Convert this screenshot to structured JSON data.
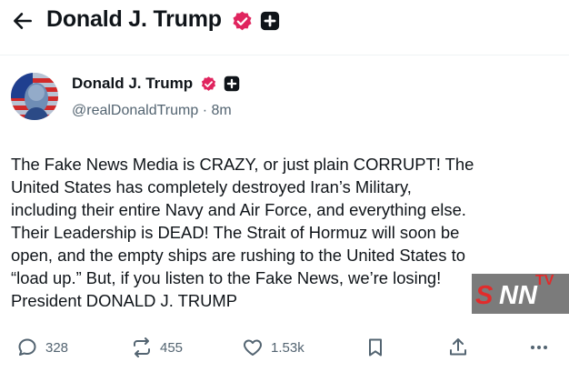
{
  "header": {
    "title": "Donald J. Trump"
  },
  "post": {
    "author": {
      "display_name": "Donald J. Trump",
      "handle": "@realDonaldTrump",
      "separator": "·",
      "time": "8m"
    },
    "text": "The Fake News Media is CRAZY, or just plain CORRUPT! The\nUnited States has completely destroyed Iran’s Military,\nincluding their entire Navy and Air Force, and everything else.\nTheir Leadership is DEAD! The Strait of Hormuz will soon be\nopen, and the empty ships are rushing to the United States to\n“load up.” But, if you listen to the Fake News, we’re losing!\nPresident DONALD J. TRUMP"
  },
  "actions": {
    "replies": "328",
    "reposts": "455",
    "likes": "1.53k"
  },
  "watermark": {
    "s": "S",
    "nn": "NN",
    "tv": "TV"
  },
  "icons": {
    "back": "arrow-left-icon",
    "verified": "verified-badge-icon",
    "plus": "plus-badge-icon",
    "reply": "reply-icon",
    "repost": "repost-icon",
    "like": "heart-icon",
    "bookmark": "bookmark-icon",
    "share": "share-icon",
    "more": "more-icon"
  },
  "colors": {
    "verified": "#e0245e",
    "text": "#0f1419",
    "secondary": "#536471"
  }
}
